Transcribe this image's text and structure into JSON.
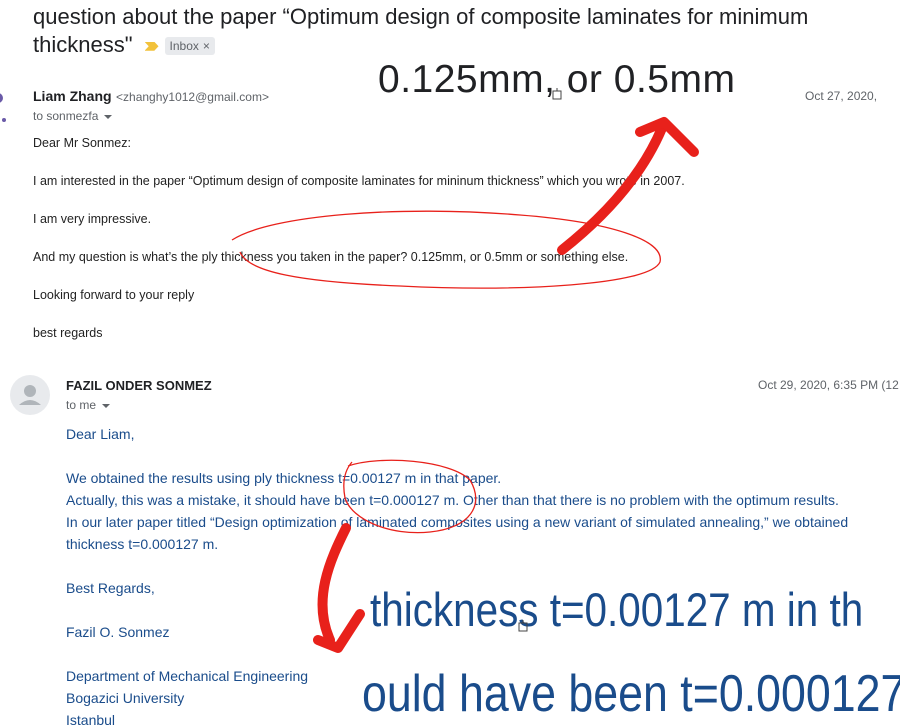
{
  "subject": "question about the paper “Optimum design of composite laminates for minimum thickness\"",
  "label": "Inbox",
  "label_close": "×",
  "message1": {
    "sender_name": "Liam Zhang",
    "sender_email": "<zhanghy1012@gmail.com>",
    "to": "to sonmezfa",
    "date": "Oct 27, 2020,",
    "body": [
      "Dear Mr Sonmez:",
      "I am interested in the paper “Optimum design of composite laminates for mininum thickness”  which you wrote in 2007.",
      "I am very impressive.",
      "And my question is what’s the ply thickness you taken in the paper?   0.125mm, or 0.5mm or something else.",
      "Looking forward to your reply",
      "best regards"
    ]
  },
  "message2": {
    "sender_name": "FAZIL ONDER SONMEZ",
    "to": "to me",
    "date": "Oct 29, 2020, 6:35 PM (12",
    "body": [
      "Dear Liam,",
      "We obtained the results using ply thickness t=0.00127 m in that paper.",
      "Actually, this was a mistake, it should have been t=0.000127 m. Other than that there is no problem with the optimum results.",
      "In our later paper titled “Design optimization of laminated composites using a new variant of simulated annealing,” we obtained",
      "thickness t=0.000127 m.",
      "Best Regards,",
      "Fazil O. Sonmez",
      "Department of Mechanical Engineering",
      "Bogazici University",
      "Istanbul"
    ]
  },
  "annotations": {
    "zoom_top": "0.125mm, or 0.5mm",
    "zoom_mid": "thickness t=0.00127 m in th",
    "zoom_bottom": "ould have been t=0.000127",
    "marker_color": "#e8211b"
  }
}
